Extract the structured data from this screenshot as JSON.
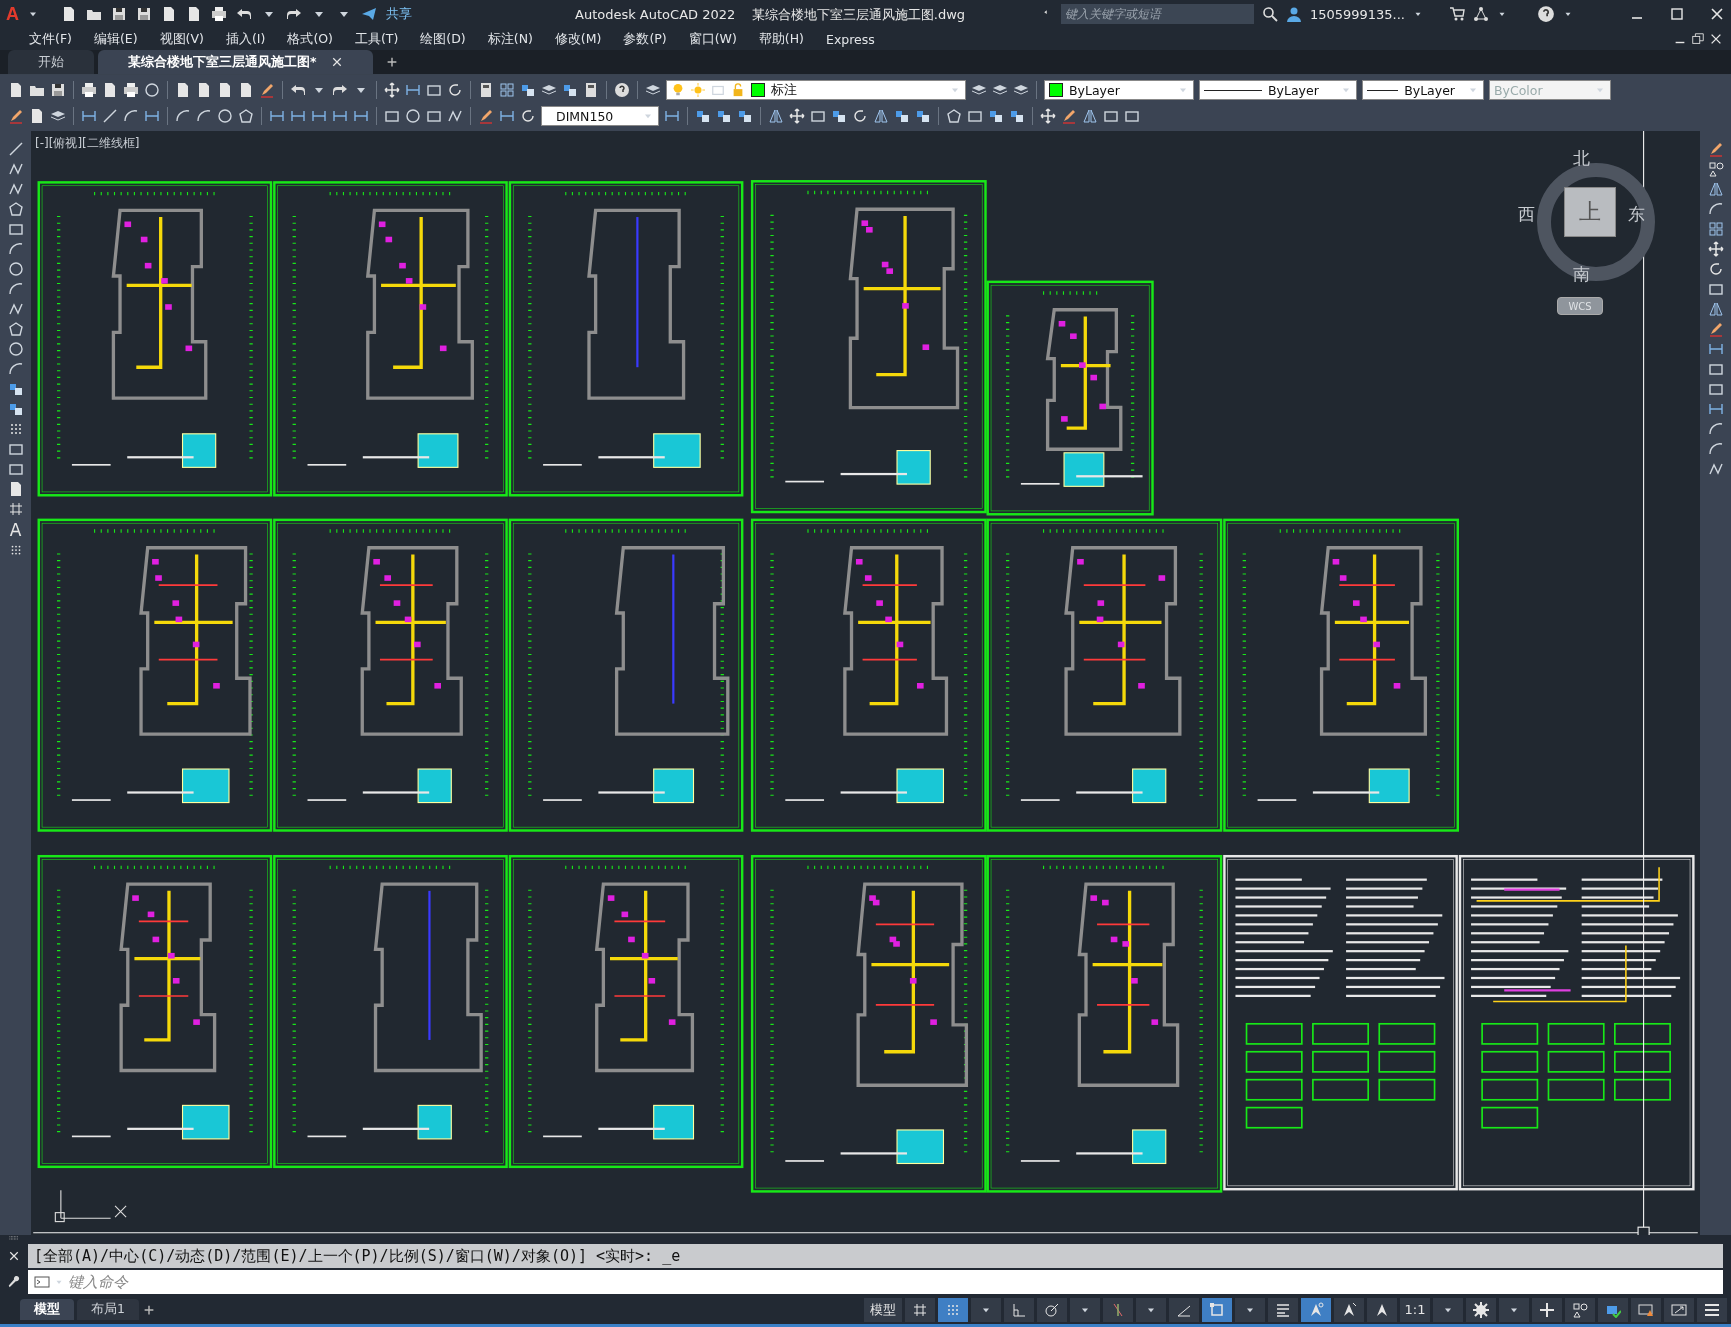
{
  "title_bar": {
    "logo": "A",
    "share": "共享",
    "title": "Autodesk AutoCAD 2022",
    "file_name": "某综合楼地下室三层通风施工图.dwg",
    "search": {
      "placeholder": "键入关键字或短语"
    },
    "user": "1505999135..."
  },
  "menu": [
    "文件(F)",
    "编辑(E)",
    "视图(V)",
    "插入(I)",
    "格式(O)",
    "工具(T)",
    "绘图(D)",
    "标注(N)",
    "修改(M)",
    "参数(P)",
    "窗口(W)",
    "帮助(H)",
    "Express"
  ],
  "file_tabs": [
    {
      "label": "开始",
      "selected": false
    },
    {
      "label": "某综合楼地下室三层通风施工图*",
      "selected": true
    }
  ],
  "properties": {
    "layer": "标注",
    "dim_style": "DIMN150",
    "color_control": "ByLayer",
    "linetype": "ByLayer",
    "lineweight": "ByLayer",
    "plot_style": {
      "value": "ByColor",
      "disabled": true
    }
  },
  "left_tools": {
    "text_tool": "A"
  },
  "viewport": {
    "label": "[-][俯视][二维线框]",
    "viewcube": {
      "north": "北",
      "south": "南",
      "east": "东",
      "west": "西",
      "face": "上",
      "ucs": "WCS"
    }
  },
  "command": {
    "history": "[全部(A)/中心(C)/动态(D)/范围(E)/上一个(P)/比例(S)/窗口(W)/对象(O)] <实时>: _e",
    "placeholder": "键入命令"
  },
  "layout_tabs": [
    {
      "label": "模型",
      "selected": true
    },
    {
      "label": "布局1",
      "selected": false
    }
  ],
  "status_bar": {
    "space": "模型",
    "scale": "1:1",
    "toggles": [
      {
        "kind": "grid",
        "on": false
      },
      {
        "kind": "snap",
        "on": true
      },
      {
        "kind": "ortho",
        "on": false
      },
      {
        "kind": "polar",
        "on": false
      },
      {
        "kind": "track",
        "on": false
      },
      {
        "kind": "iso",
        "on": false
      },
      {
        "kind": "osnap",
        "on": true
      },
      {
        "kind": "lineweight",
        "on": false
      },
      {
        "kind": "annovis",
        "on": true
      },
      {
        "kind": "autoscale",
        "on": false
      },
      {
        "kind": "annoscale",
        "on": false
      }
    ]
  }
}
